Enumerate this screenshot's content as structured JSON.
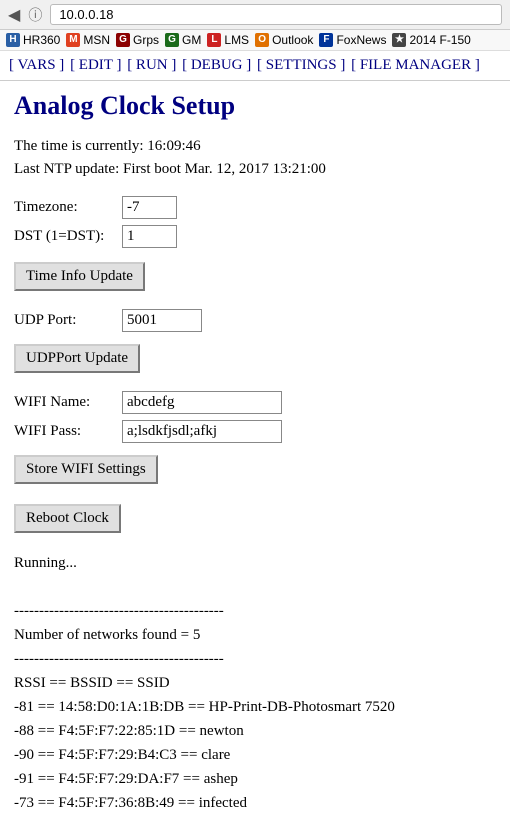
{
  "browser": {
    "back_icon": "◀",
    "info_icon": "ⓘ",
    "url": "10.0.0.18"
  },
  "bookmarks": [
    {
      "icon_bg": "#2a5fa5",
      "icon_text": "HR",
      "label": "HR360"
    },
    {
      "icon_bg": "#e04020",
      "icon_text": "M",
      "label": "MSN"
    },
    {
      "icon_bg": "#8b0000",
      "icon_text": "G",
      "label": "Grps"
    },
    {
      "icon_bg": "#1a6a1a",
      "icon_text": "G",
      "label": "GM"
    },
    {
      "icon_bg": "#cc2222",
      "icon_text": "L",
      "label": "LMS"
    },
    {
      "icon_bg": "#e07000",
      "icon_text": "O",
      "label": "Outlook"
    },
    {
      "icon_bg": "#003399",
      "icon_text": "F",
      "label": "FoxNews"
    },
    {
      "icon_bg": "#444444",
      "icon_text": "★",
      "label": "2014 F-150"
    }
  ],
  "nav": {
    "items": [
      {
        "label": "[ VARS ]"
      },
      {
        "label": "[ EDIT ]"
      },
      {
        "label": "[ RUN ]"
      },
      {
        "label": "[ DEBUG ]"
      },
      {
        "label": "[ SETTINGS ]"
      },
      {
        "label": "[ FILE MANAGER ]"
      }
    ]
  },
  "page": {
    "title": "Analog Clock Setup",
    "time_label": "The time is currently: 16:09:46",
    "ntp_label": "Last NTP update: First boot Mar. 12, 2017 13:21:00",
    "timezone_label": "Timezone:",
    "timezone_value": "-7",
    "dst_label": "DST (1=DST):",
    "dst_value": "1",
    "time_update_btn": "Time Info Update",
    "udp_port_label": "UDP Port:",
    "udp_port_value": "5001",
    "udp_update_btn": "UDPPort Update",
    "wifi_name_label": "WIFI Name:",
    "wifi_name_value": "abcdefg",
    "wifi_pass_label": "WIFI Pass:",
    "wifi_pass_value": "a;lsdkfjsdl;afkj",
    "store_wifi_btn": "Store WIFI Settings",
    "reboot_btn": "Reboot Clock",
    "output": "Running...\n\n------------------------------------------\nNumber of networks found = 5\n------------------------------------------\nRSSI == BSSID == SSID\n-81 == 14:58:D0:1A:1B:DB == HP-Print-DB-Photosmart 7520\n-88 == F4:5F:F7:22:85:1D == newton\n-90 == F4:5F:F7:29:B4:C3 == clare\n-91 == F4:5F:F7:29:DA:F7 == ashep\n-73 == F4:5F:F7:36:8B:49 == infected"
  }
}
